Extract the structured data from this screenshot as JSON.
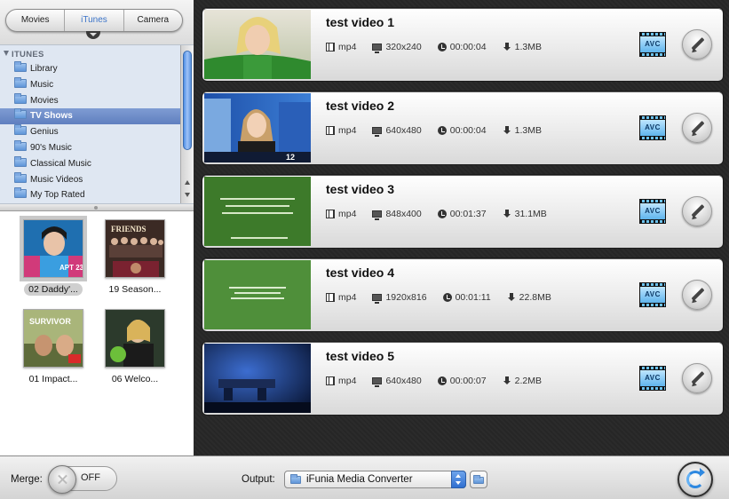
{
  "source_tabs": [
    {
      "label": "Movies",
      "active": false
    },
    {
      "label": "iTunes",
      "active": true
    },
    {
      "label": "Camera",
      "active": false
    }
  ],
  "library": {
    "header": "ITUNES",
    "items": [
      {
        "label": "Library",
        "selected": false
      },
      {
        "label": "Music",
        "selected": false
      },
      {
        "label": "Movies",
        "selected": false
      },
      {
        "label": "TV Shows",
        "selected": true
      },
      {
        "label": "Genius",
        "selected": false
      },
      {
        "label": "90's Music",
        "selected": false
      },
      {
        "label": "Classical Music",
        "selected": false
      },
      {
        "label": "Music Videos",
        "selected": false
      },
      {
        "label": "My Top Rated",
        "selected": false
      }
    ]
  },
  "media_items": [
    {
      "caption": "02 Daddy'...",
      "selected": true
    },
    {
      "caption": "19 Season...",
      "selected": false
    },
    {
      "caption": "01 Impact...",
      "selected": false
    },
    {
      "caption": "06 Welco...",
      "selected": false
    }
  ],
  "videos": [
    {
      "title": "test video 1",
      "format": "mp4",
      "resolution": "320x240",
      "duration": "00:00:04",
      "size": "1.3MB",
      "codec_badge": "AVC"
    },
    {
      "title": "test video 2",
      "format": "mp4",
      "resolution": "640x480",
      "duration": "00:00:04",
      "size": "1.3MB",
      "codec_badge": "AVC"
    },
    {
      "title": "test video 3",
      "format": "mp4",
      "resolution": "848x400",
      "duration": "00:01:37",
      "size": "31.1MB",
      "codec_badge": "AVC"
    },
    {
      "title": "test video 4",
      "format": "mp4",
      "resolution": "1920x816",
      "duration": "00:01:11",
      "size": "22.8MB",
      "codec_badge": "AVC"
    },
    {
      "title": "test video 5",
      "format": "mp4",
      "resolution": "640x480",
      "duration": "00:00:07",
      "size": "2.2MB",
      "codec_badge": "AVC"
    }
  ],
  "bottom_bar": {
    "merge_label": "Merge:",
    "merge_state": "OFF",
    "output_label": "Output:",
    "output_value": "iFunia Media Converter"
  },
  "colors": {
    "selection": "#6585c4",
    "sidebar_bg": "#dfe7f2",
    "active_tab": "#3c74c8",
    "main_bg": "#2a2a2a",
    "convert_accent": "#2e88e0"
  }
}
